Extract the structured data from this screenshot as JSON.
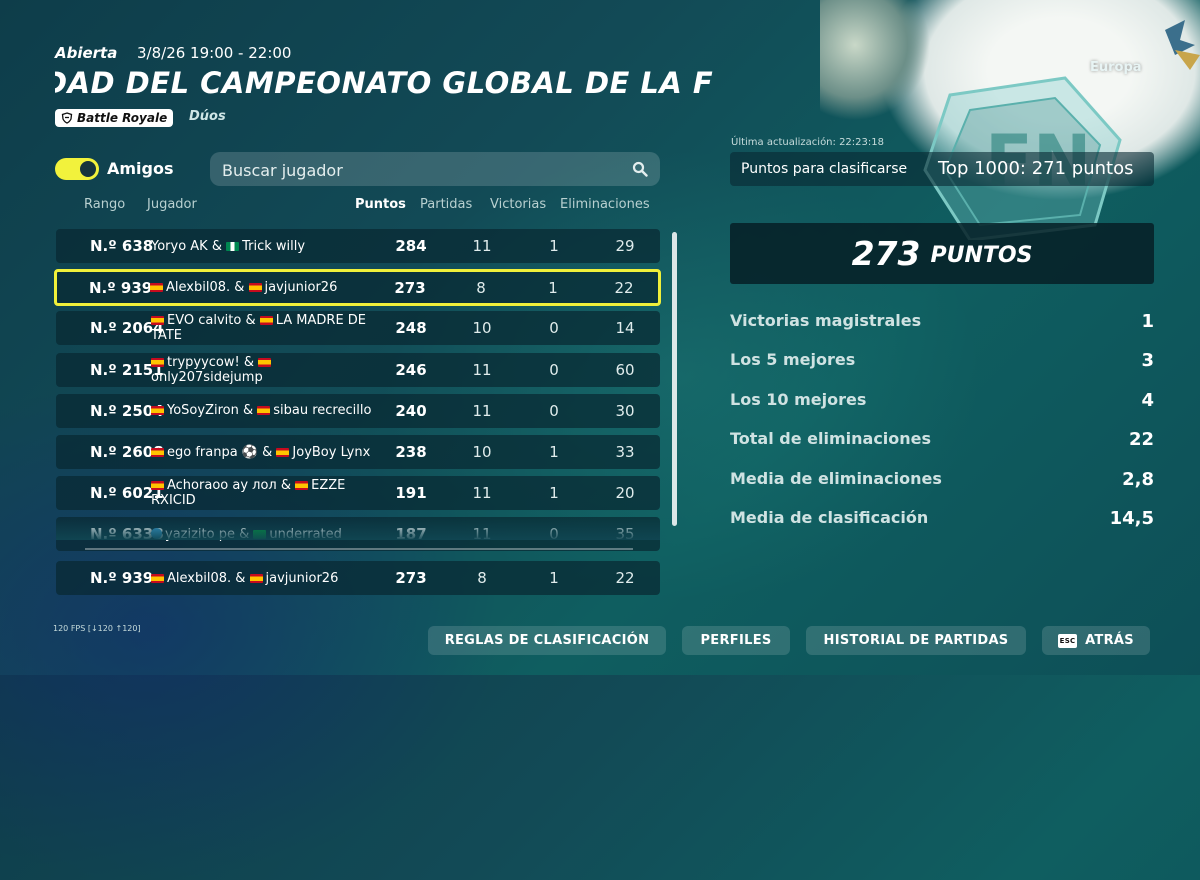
{
  "header": {
    "status": "Abierta",
    "dates": "3/8/26 19:00 - 22:00",
    "title": "DAD DEL CAMPEONATO GLOBAL DE LA F",
    "mode_badge": "Battle Royale",
    "mode_type": "Dúos",
    "region": "Europa"
  },
  "filters": {
    "friends_toggle_label": "Amigos",
    "friends_toggle_on": true,
    "search_placeholder": "Buscar jugador"
  },
  "table": {
    "columns": {
      "rank": "Rango",
      "player": "Jugador",
      "points": "Puntos",
      "matches": "Partidas",
      "wins": "Victorias",
      "elims": "Eliminaciones"
    },
    "rows": [
      {
        "rank": "N.º 638",
        "p1": "Yoryo AK",
        "p1_flag": "",
        "p2": "Trick willy",
        "p2_flag": "ng",
        "points": "284",
        "matches": "11",
        "wins": "1",
        "elims": "29"
      },
      {
        "rank": "N.º 939",
        "p1": "Alexbil08.",
        "p1_flag": "es",
        "p2": "javjunior26",
        "p2_flag": "es",
        "points": "273",
        "matches": "8",
        "wins": "1",
        "elims": "22",
        "highlight": true
      },
      {
        "rank": "N.º 2064",
        "p1": "EVO calvito",
        "p1_flag": "es",
        "p2": "LA MADRE DE TATE",
        "p2_flag": "es",
        "points": "248",
        "matches": "10",
        "wins": "0",
        "elims": "14"
      },
      {
        "rank": "N.º 2151",
        "p1": "trypyycow!",
        "p1_flag": "es",
        "p2": "only207sidejump",
        "p2_flag": "es",
        "points": "246",
        "matches": "11",
        "wins": "0",
        "elims": "60"
      },
      {
        "rank": "N.º 2504",
        "p1": "YoSoyZiron",
        "p1_flag": "es",
        "p2": "sibau recrecillo",
        "p2_flag": "es",
        "points": "240",
        "matches": "11",
        "wins": "0",
        "elims": "30"
      },
      {
        "rank": "N.º 2608",
        "p1": "ego franpa ⚽",
        "p1_flag": "es",
        "p2": "JoyBoy Lynx",
        "p2_flag": "es",
        "points": "238",
        "matches": "10",
        "wins": "1",
        "elims": "33"
      },
      {
        "rank": "N.º 6021",
        "p1": "Achoraoo ay лол",
        "p1_flag": "es",
        "p2": "EZZE RXICID",
        "p2_flag": "es",
        "points": "191",
        "matches": "11",
        "wins": "1",
        "elims": "20"
      },
      {
        "rank": "N.º 6338",
        "p1": "yazizito pe",
        "p1_flag": "gl",
        "p2": "underrated",
        "p2_flag": "br",
        "points": "187",
        "matches": "11",
        "wins": "0",
        "elims": "35"
      }
    ],
    "self_row": {
      "rank": "N.º 939",
      "p1": "Alexbil08.",
      "p1_flag": "es",
      "p2": "javjunior26",
      "p2_flag": "es",
      "points": "273",
      "matches": "8",
      "wins": "1",
      "elims": "22"
    }
  },
  "summary": {
    "last_update": "Última actualización: 22:23:18",
    "qualify_label": "Puntos para clasificarse",
    "qualify_value": "Top 1000: 271 puntos",
    "total_points": "273",
    "total_points_label": "PUNTOS",
    "stats": [
      {
        "label": "Victorias magistrales",
        "value": "1"
      },
      {
        "label": "Los 5 mejores",
        "value": "3"
      },
      {
        "label": "Los 10 mejores",
        "value": "4"
      },
      {
        "label": "Total de eliminaciones",
        "value": "22"
      },
      {
        "label": "Media de eliminaciones",
        "value": "2,8"
      },
      {
        "label": "Media de clasificación",
        "value": "14,5"
      }
    ]
  },
  "footer": {
    "fps": "120 FPS [↓120 ↑120]",
    "buttons": {
      "rules": "REGLAS DE CLASIFICACIÓN",
      "profiles": "PERFILES",
      "history": "HISTORIAL DE PARTIDAS",
      "back": "ATRÁS",
      "back_key": "ESC"
    }
  },
  "colors": {
    "highlight": "#f0f03a",
    "toggle_on": "#f2f23c",
    "row_bg": "#0a2a33"
  }
}
